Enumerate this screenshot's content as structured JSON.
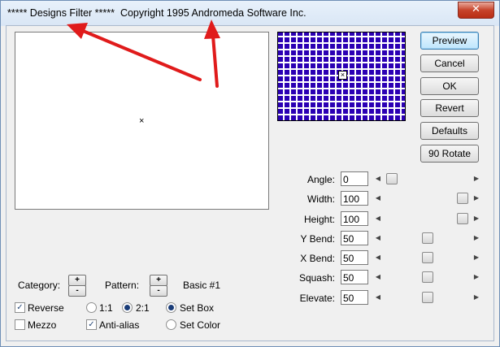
{
  "window": {
    "title": "***** Designs Filter *****  Copyright 1995 Andromeda Software Inc.",
    "close_label": "✕"
  },
  "preview": {
    "crosshair": "×"
  },
  "pattern_preview": {
    "color": "#2b00b4",
    "cursor": "×"
  },
  "buttons": {
    "preview": "Preview",
    "cancel": "Cancel",
    "ok": "OK",
    "revert": "Revert",
    "defaults": "Defaults",
    "rotate": "90 Rotate"
  },
  "sliders": [
    {
      "label": "Angle:",
      "value": "0",
      "position": 0.03
    },
    {
      "label": "Width:",
      "value": "100",
      "position": 0.97
    },
    {
      "label": "Height:",
      "value": "100",
      "position": 0.97
    },
    {
      "label": "Y Bend:",
      "value": "50",
      "position": 0.5
    },
    {
      "label": "X Bend:",
      "value": "50",
      "position": 0.5
    },
    {
      "label": "Squash:",
      "value": "50",
      "position": 0.5
    },
    {
      "label": "Elevate:",
      "value": "50",
      "position": 0.5
    }
  ],
  "category": {
    "label": "Category:",
    "plus": "+",
    "minus": "-"
  },
  "pattern": {
    "label": "Pattern:",
    "plus": "+",
    "minus": "-",
    "name": "Basic #1"
  },
  "options": {
    "reverse": {
      "label": "Reverse",
      "checked": true
    },
    "mezzo": {
      "label": "Mezzo",
      "checked": false
    },
    "anti_alias": {
      "label": "Anti-alias",
      "checked": true
    },
    "ratio_1_1": {
      "label": "1:1",
      "selected": false
    },
    "ratio_2_1": {
      "label": "2:1",
      "selected": true
    },
    "set_box": {
      "label": "Set Box",
      "selected": true
    },
    "set_color": {
      "label": "Set Color",
      "selected": false
    },
    "check_mark": "✓"
  },
  "annotation": {
    "arrow_color": "#e01b1b"
  }
}
